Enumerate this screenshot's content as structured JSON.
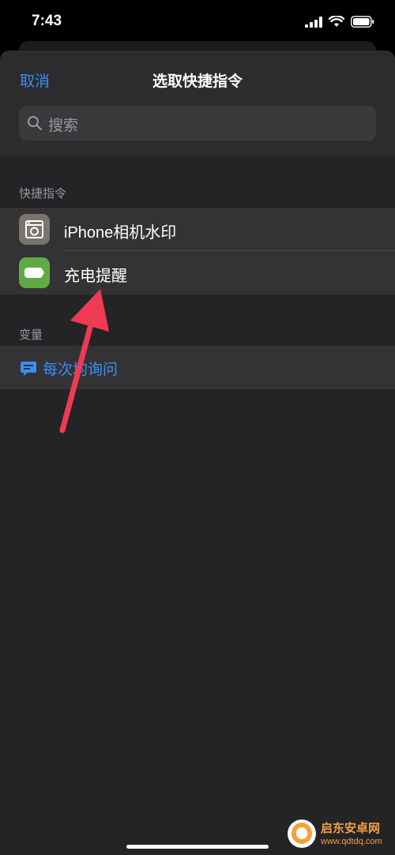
{
  "status_bar": {
    "time": "7:43"
  },
  "nav": {
    "cancel_label": "取消",
    "title": "选取快捷指令"
  },
  "search": {
    "placeholder": "搜索"
  },
  "sections": {
    "shortcuts_header": "快捷指令",
    "variables_header": "变量"
  },
  "shortcuts": [
    {
      "label": "iPhone相机水印",
      "icon": "camera-icon",
      "color": "#7b746d"
    },
    {
      "label": "充电提醒",
      "icon": "battery-icon",
      "color": "#5eab46"
    }
  ],
  "variables": [
    {
      "label": "每次均询问",
      "icon": "speech-bubble-icon",
      "color": "#3a8ef6"
    }
  ],
  "watermark": {
    "text": "启东安卓网",
    "url": "www.qdtdq.com"
  },
  "colors": {
    "accent": "#3a8ef6",
    "arrow": "#f03a54"
  }
}
